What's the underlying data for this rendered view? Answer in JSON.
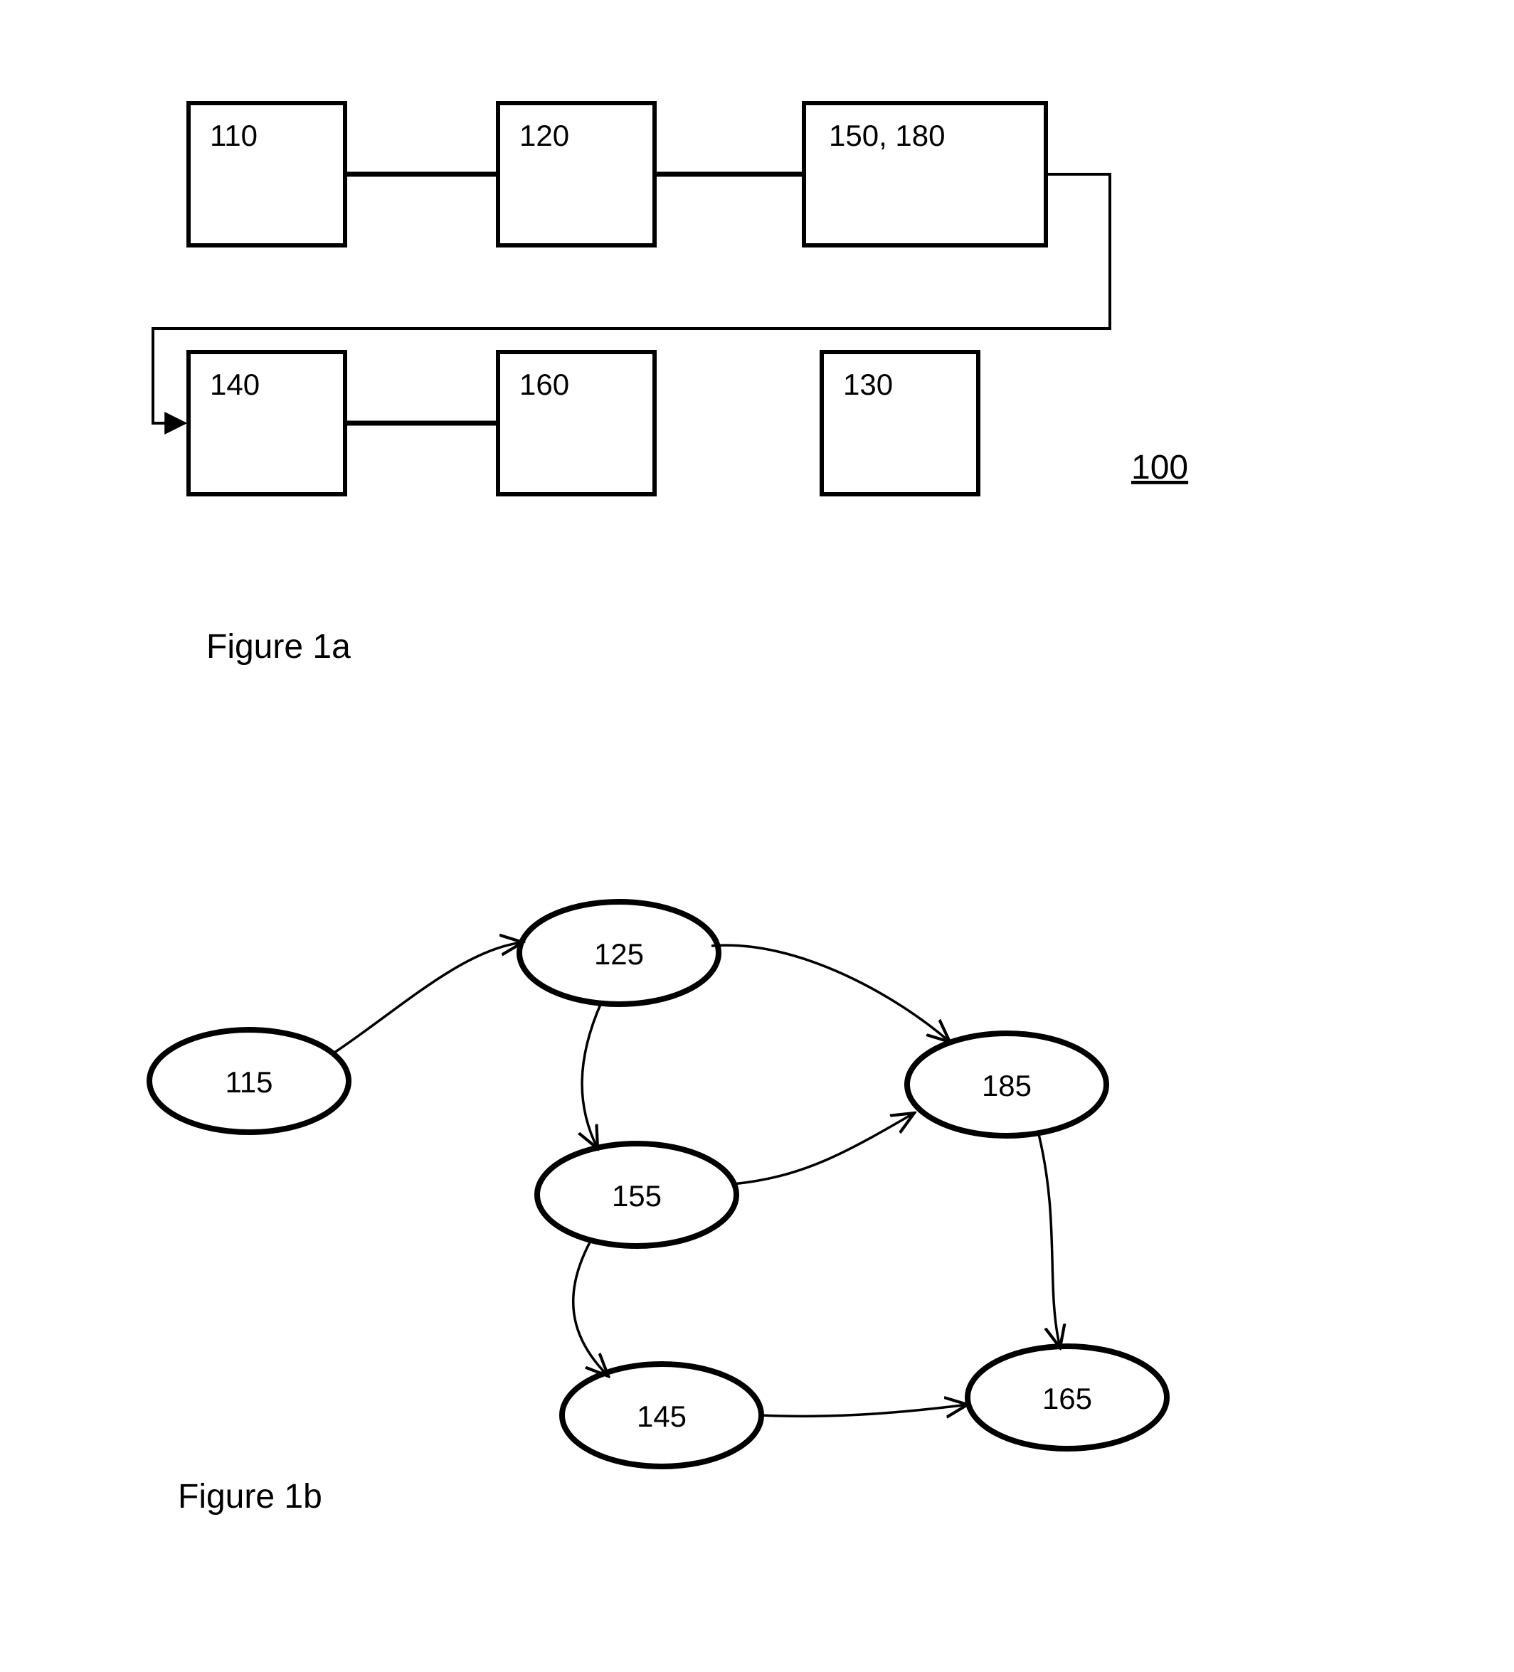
{
  "figure_a": {
    "caption": "Figure 1a",
    "ref": "100",
    "boxes": {
      "b110": "110",
      "b120": "120",
      "b150_180": "150, 180",
      "b140": "140",
      "b160": "160",
      "b130": "130"
    }
  },
  "figure_b": {
    "caption": "Figure 1b",
    "nodes": {
      "n115": "115",
      "n125": "125",
      "n155": "155",
      "n185": "185",
      "n145": "145",
      "n165": "165"
    }
  }
}
